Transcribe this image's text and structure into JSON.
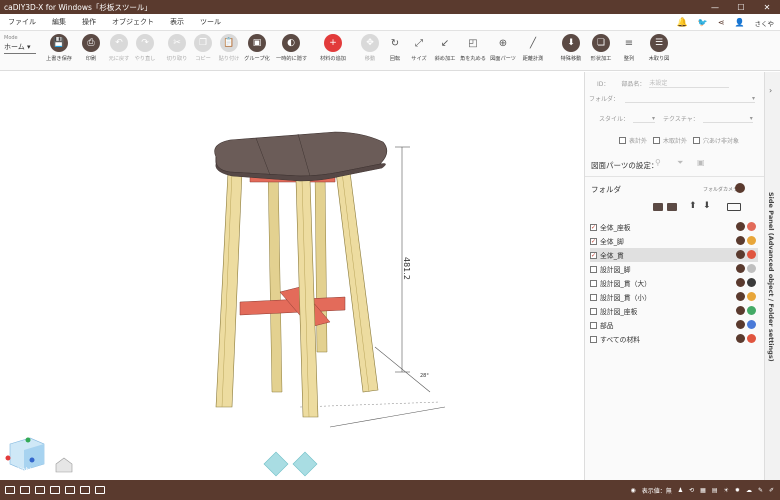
{
  "window": {
    "title": "caDIY3D-X for Windows「杉板スツール」",
    "min": "—",
    "max": "☐",
    "close": "✕"
  },
  "menu": {
    "items": [
      "ファイル",
      "編集",
      "操作",
      "オブジェクト",
      "表示",
      "ツール"
    ],
    "user": "さくや"
  },
  "ribbon": {
    "mode_label": "Mode",
    "mode_value": "ホーム",
    "tools": [
      {
        "name": "overwrite-save",
        "label": "上書き保存",
        "style": "dark",
        "icon": "💾"
      },
      {
        "name": "print",
        "label": "印刷",
        "style": "dark",
        "icon": "⎙"
      },
      {
        "name": "undo",
        "label": "元に戻す",
        "style": "light",
        "icon": "↶"
      },
      {
        "name": "redo",
        "label": "やり直し",
        "style": "light",
        "icon": "↷"
      },
      {
        "name": "cut",
        "label": "切り取り",
        "style": "light",
        "icon": "✂"
      },
      {
        "name": "copy",
        "label": "コピー",
        "style": "light",
        "icon": "❐"
      },
      {
        "name": "paste",
        "label": "貼り付け",
        "style": "light",
        "icon": "📋"
      },
      {
        "name": "group",
        "label": "グループ化",
        "style": "dark",
        "icon": "▣"
      },
      {
        "name": "hide-temp",
        "label": "一時的に隠す",
        "style": "dark",
        "icon": "◐"
      },
      {
        "name": "add-material",
        "label": "材料の追加",
        "style": "red",
        "icon": "+"
      },
      {
        "name": "move",
        "label": "移動",
        "style": "light",
        "icon": "✥"
      },
      {
        "name": "rotate",
        "label": "回転",
        "style": "flat",
        "icon": "↻"
      },
      {
        "name": "size",
        "label": "サイズ",
        "style": "flat",
        "icon": "⤢"
      },
      {
        "name": "diagonal-cut",
        "label": "斜め加工",
        "style": "flat",
        "icon": "↙"
      },
      {
        "name": "round-corner",
        "label": "角を丸める",
        "style": "flat",
        "icon": "◰"
      },
      {
        "name": "drawing-parts",
        "label": "図面パーツ",
        "style": "flat",
        "icon": "⊕"
      },
      {
        "name": "distance-measure",
        "label": "距離計測",
        "style": "flat",
        "icon": "╱"
      },
      {
        "name": "special-move",
        "label": "特殊移動",
        "style": "dark",
        "icon": "⬇"
      },
      {
        "name": "shape-process",
        "label": "形状加工",
        "style": "dark",
        "icon": "❏"
      },
      {
        "name": "align",
        "label": "整列",
        "style": "flat",
        "icon": "≡"
      },
      {
        "name": "cut-list",
        "label": "木取り図",
        "style": "dark",
        "icon": "☰"
      }
    ]
  },
  "panel": {
    "id_label": "ID：",
    "part_name_label": "部品名：",
    "part_name_placeholder": "未設定",
    "folder_label": "フォルダ：",
    "style_label": "スタイル：",
    "texture_label": "テクスチャ：",
    "checks": [
      "表計外",
      "木取計外",
      "穴あけ非対象"
    ],
    "drawing_settings": "図面パーツの設定：",
    "folder_title": "フォルダ",
    "folder_camera": "フォルダカメラ",
    "folders": [
      {
        "label": "全体_座板",
        "checked": true,
        "selected": false
      },
      {
        "label": "全体_脚",
        "checked": true,
        "selected": false
      },
      {
        "label": "全体_貫",
        "checked": true,
        "selected": true
      },
      {
        "label": "設計図_脚",
        "checked": false,
        "selected": false
      },
      {
        "label": "設計図_貫（大）",
        "checked": false,
        "selected": false
      },
      {
        "label": "設計図_貫（小）",
        "checked": false,
        "selected": false
      },
      {
        "label": "設計図_座板",
        "checked": false,
        "selected": false
      },
      {
        "label": "部品",
        "checked": false,
        "selected": false
      },
      {
        "label": "すべての材料",
        "checked": false,
        "selected": false
      }
    ],
    "side_tab": "Side Panel (Advanced object / Folder settings)"
  },
  "viewport": {
    "dim_height": "481.2",
    "dim_small": "28°",
    "cube_label": "Right"
  },
  "status": {
    "display_text": "表示値：無"
  }
}
